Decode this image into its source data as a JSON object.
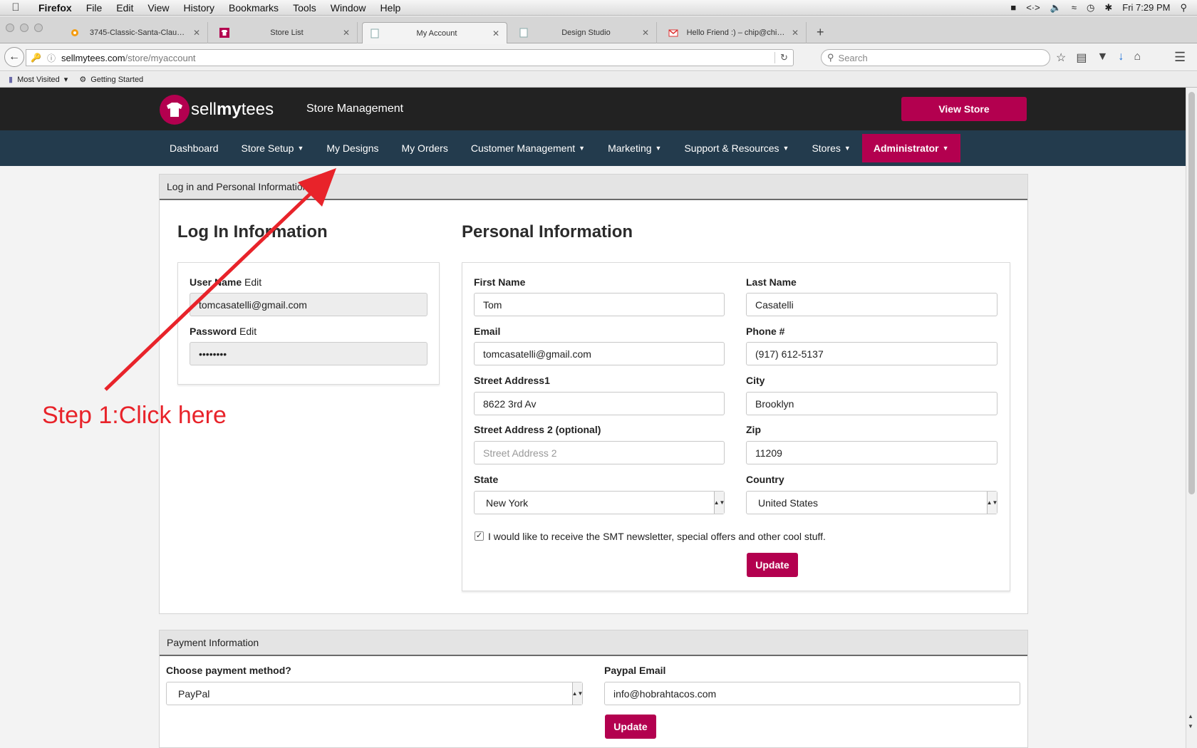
{
  "menubar": {
    "app": "Firefox",
    "items": [
      "File",
      "Edit",
      "View",
      "History",
      "Bookmarks",
      "Tools",
      "Window",
      "Help"
    ],
    "clock": "Fri 7:29 PM"
  },
  "tabs": [
    {
      "title": "3745-Classic-Santa-Clau…",
      "icon": "gear-favicon-icon"
    },
    {
      "title": "Store List",
      "icon": "shirt-favicon-icon"
    },
    {
      "title": "My Account",
      "icon": "page-favicon-icon"
    },
    {
      "title": "Design Studio",
      "icon": "page-favicon-icon"
    },
    {
      "title": "Hello Friend :) – chip@chi…",
      "icon": "gmail-favicon-icon"
    }
  ],
  "urlbar": {
    "host": "sellmytees.com",
    "path": "/store/myaccount"
  },
  "search": {
    "placeholder": "Search"
  },
  "bookmarks": [
    "Most Visited",
    "Getting Started"
  ],
  "header": {
    "logo_sell": "sell",
    "logo_my": "my",
    "logo_tees": "tees",
    "title": "Store Management",
    "view_store": "View Store"
  },
  "nav": {
    "dashboard": "Dashboard",
    "store_setup": "Store Setup",
    "my_designs": "My Designs",
    "my_orders": "My Orders",
    "customer_management": "Customer Management",
    "marketing": "Marketing",
    "support": "Support & Resources",
    "stores": "Stores",
    "administrator": "Administrator"
  },
  "login_panel": {
    "heading": "Log in and Personal Information",
    "login_title": "Log In Information",
    "username_label": "User Name",
    "username_edit": "Edit",
    "username_value": "tomcasatelli@gmail.com",
    "password_label": "Password",
    "password_edit": "Edit",
    "password_value": "••••••••",
    "personal_title": "Personal Information",
    "first_name_label": "First Name",
    "first_name": "Tom",
    "last_name_label": "Last Name",
    "last_name": "Casatelli",
    "email_label": "Email",
    "email": "tomcasatelli@gmail.com",
    "phone_label": "Phone #",
    "phone": "(917) 612-5137",
    "street1_label": "Street Address1",
    "street1": "8622 3rd Av",
    "city_label": "City",
    "city": "Brooklyn",
    "street2_label": "Street Address 2 (optional)",
    "street2_placeholder": "Street Address 2",
    "zip_label": "Zip",
    "zip": "11209",
    "state_label": "State",
    "state": "New York",
    "country_label": "Country",
    "country": "United States",
    "newsletter": "I would like to receive the SMT newsletter, special offers and other cool stuff.",
    "update": "Update"
  },
  "payment_panel": {
    "heading": "Payment Information",
    "method_label": "Choose payment method?",
    "method": "PayPal",
    "paypal_label": "Paypal Email",
    "paypal_email": "info@hobrahtacos.com",
    "update": "Update"
  },
  "annotation": {
    "text": "Step 1:Click here",
    "color": "#e8232a"
  },
  "colors": {
    "brand": "#b3004f",
    "nav_bg": "#233b4d",
    "header_bg": "#222222"
  }
}
